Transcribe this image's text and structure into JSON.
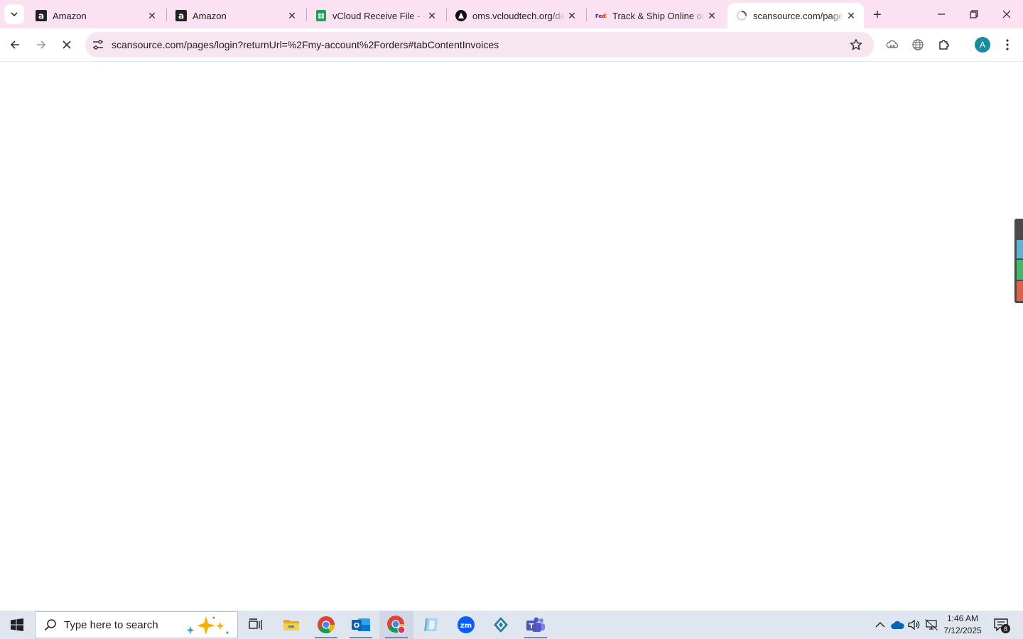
{
  "browser": {
    "tabs": [
      {
        "title": "Amazon",
        "icon": "amazon-icon",
        "active": false
      },
      {
        "title": "Amazon",
        "icon": "amazon-icon",
        "active": false
      },
      {
        "title": "vCloud Receive File - Google Sheets",
        "icon": "sheets-icon",
        "active": false
      },
      {
        "title": "oms.vcloudtech.org/dashboard",
        "icon": "oms-icon",
        "active": false
      },
      {
        "title": "Track & Ship Online or FedEx",
        "icon": "fedex-icon",
        "active": false
      },
      {
        "title": "scansource.com/pages/login",
        "icon": "loading-spinner-icon",
        "active": true
      }
    ],
    "close_glyph": "✕",
    "new_tab_glyph": "+",
    "address_bar": {
      "url": "scansource.com/pages/login?returnUrl=%2Fmy-account%2Forders#tabContentInvoices"
    },
    "profile_initial": "A"
  },
  "taskbar": {
    "search_placeholder": "Type here to search",
    "apps": [
      "task-view-icon",
      "file-explorer-icon",
      "chrome-icon",
      "outlook-icon",
      "chrome-profile-icon",
      "app-icon",
      "zoom-icon",
      "app-diamond-icon",
      "teams-icon"
    ],
    "clock": {
      "time": "1:46 AM",
      "date": "7/12/2025"
    },
    "notification_count": "8"
  },
  "colors": {
    "tab_strip": "#fbe1f1",
    "omnibox": "#f7e5f0",
    "taskbar": "#dfe6ef",
    "widget_blue": "#5bb4d8",
    "widget_green": "#3dbb6a",
    "widget_red": "#e0604c"
  }
}
